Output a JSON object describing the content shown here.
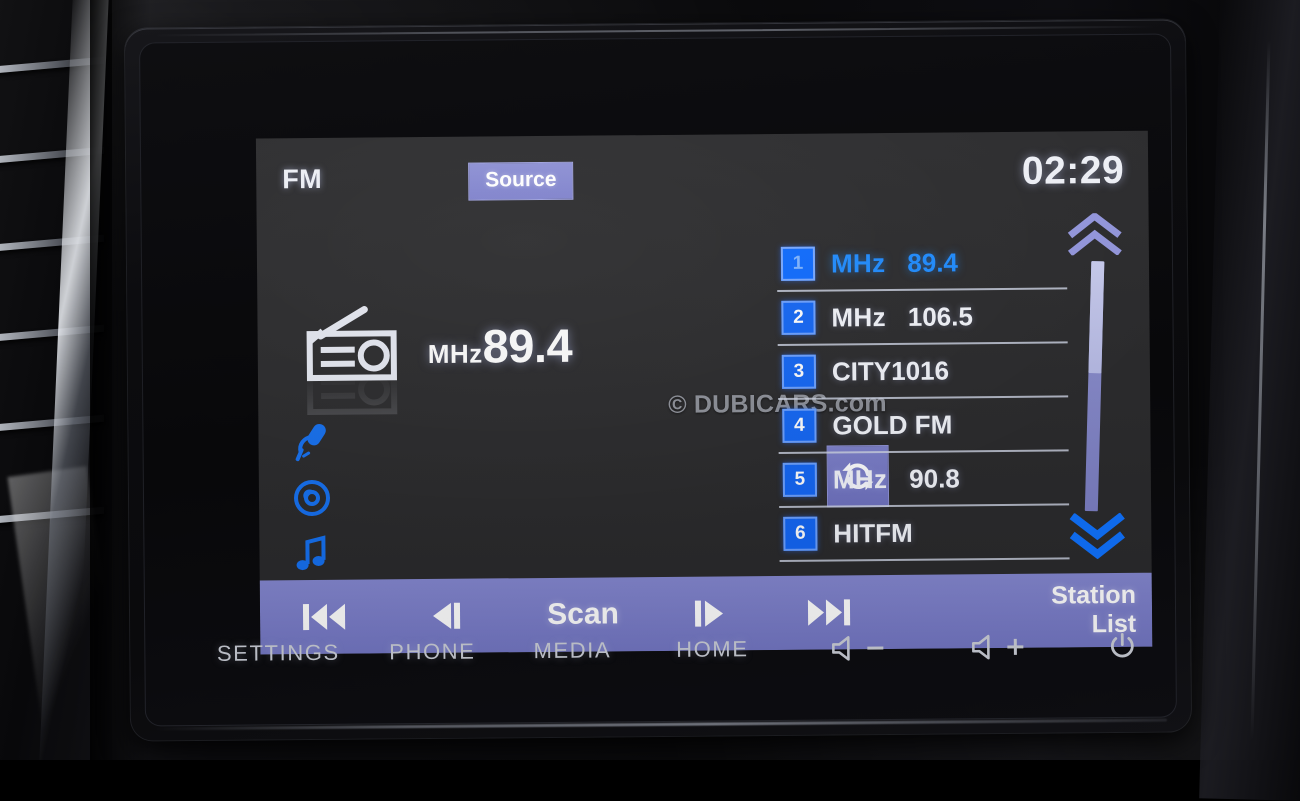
{
  "device": {
    "type": "car-infotainment-head-unit",
    "mode": "FM Radio"
  },
  "screen": {
    "header": {
      "band_label": "FM",
      "source_button": "Source",
      "clock": "02:29"
    },
    "now_playing": {
      "radio_icon": "radio-icon",
      "unit": "MHz",
      "frequency": "89.4"
    },
    "side_icons": [
      {
        "name": "microphone-icon",
        "label": "Microphone"
      },
      {
        "name": "disc-icon",
        "label": "Disc"
      },
      {
        "name": "music-note-icon",
        "label": "Music"
      }
    ],
    "refresh_button": {
      "name": "refresh-icon",
      "label": "Update List"
    },
    "watermark": "© DUBICARS.com",
    "presets": [
      {
        "number": "1",
        "unit": "MHz",
        "value": "89.4",
        "active": true
      },
      {
        "number": "2",
        "unit": "MHz",
        "value": "106.5",
        "active": false
      },
      {
        "number": "3",
        "unit": "",
        "value": "CITY1016",
        "active": false
      },
      {
        "number": "4",
        "unit": "",
        "value": "GOLD FM",
        "active": false
      },
      {
        "number": "5",
        "unit": "MHz",
        "value": "90.8",
        "active": false
      },
      {
        "number": "6",
        "unit": "",
        "value": "HITFM",
        "active": false
      }
    ],
    "scrollbar": {
      "up_arrow": "chevron-up-icon",
      "down_arrow": "chevron-down-icon",
      "thumb_position_percent": 0,
      "thumb_size_percent": 45
    },
    "control_bar": {
      "prev_track": "prev-track-icon",
      "tune_down": "tune-down-icon",
      "scan": "Scan",
      "tune_up": "tune-up-icon",
      "next_track": "next-track-icon",
      "station_list_line1": "Station",
      "station_list_line2": "List"
    }
  },
  "hardware_buttons": [
    {
      "name": "settings-button",
      "label": "SETTINGS",
      "icon": ""
    },
    {
      "name": "phone-button",
      "label": "PHONE",
      "icon": ""
    },
    {
      "name": "media-button",
      "label": "MEDIA",
      "icon": ""
    },
    {
      "name": "home-button",
      "label": "HOME",
      "icon": ""
    },
    {
      "name": "volume-down-button",
      "label": "",
      "icon": "speaker-minus-icon"
    },
    {
      "name": "volume-up-button",
      "label": "",
      "icon": "speaker-plus-icon"
    },
    {
      "name": "power-button",
      "label": "",
      "icon": "power-icon"
    }
  ],
  "colors": {
    "accent_blue": "#1e8bff",
    "bar_purple": "#7f82cd",
    "lcd_background": "#2a2a2c",
    "text_white": "#f2f4fa",
    "hw_label_gray": "#b9bcc4"
  }
}
